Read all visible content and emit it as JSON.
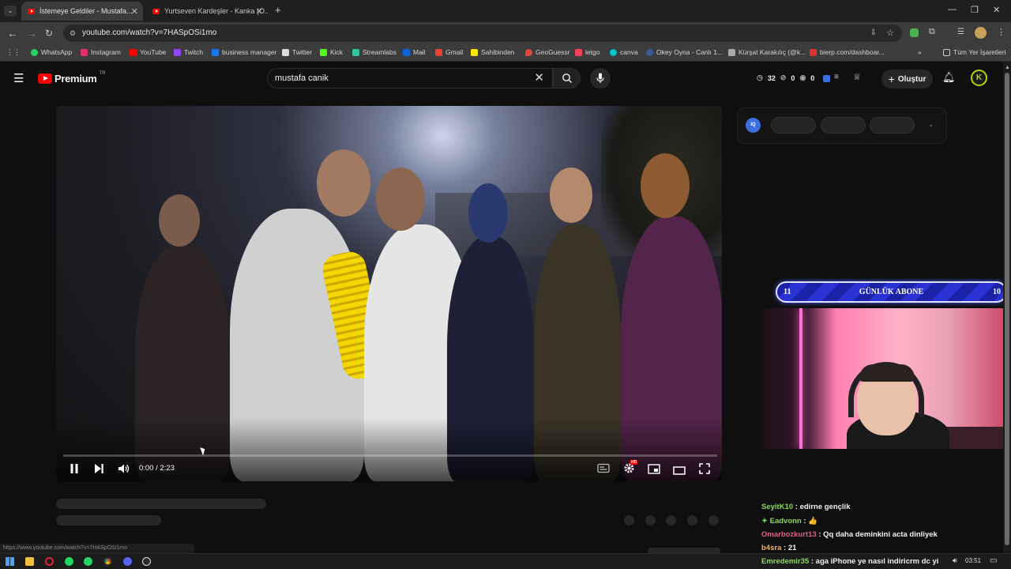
{
  "browser": {
    "tabs": [
      {
        "title": "İstemeye Geldiler - Mustafa..."
      },
      {
        "title": "Yurtseven Kardeşler - Kanka (O..."
      }
    ],
    "new_tab": "+",
    "url": "youtube.com/watch?v=7HASpOSi1mo",
    "bookmarks": [
      {
        "label": "WhatsApp",
        "color": "#25d366"
      },
      {
        "label": "Instagram",
        "color": "#e1306c"
      },
      {
        "label": "YouTube",
        "color": "#ff0000"
      },
      {
        "label": "Twitch",
        "color": "#9146ff"
      },
      {
        "label": "business manager",
        "color": "#1877f2"
      },
      {
        "label": "Twitter",
        "color": "#ffffff"
      },
      {
        "label": "Kick",
        "color": "#53fc18"
      },
      {
        "label": "Streamlabs",
        "color": "#31c3a2"
      },
      {
        "label": "Mail",
        "color": "#0a64d8"
      },
      {
        "label": "Gmail",
        "color": "#ea4335"
      },
      {
        "label": "Sahibinden",
        "color": "#ffe800"
      },
      {
        "label": "GeoGuessr",
        "color": "#e0463e"
      },
      {
        "label": "letgo",
        "color": "#ff3f55"
      },
      {
        "label": "canva",
        "color": "#00c4cc"
      },
      {
        "label": "Okey Oyna - Canlı 1...",
        "color": "#3b5998"
      },
      {
        "label": "Kürşat Karakılıç (@k...",
        "color": "#cccccc"
      },
      {
        "label": "bierp.com/dashboar...",
        "color": "#d33"
      }
    ],
    "all_bookmarks": "Tüm Yer İşaretleri",
    "status_url": "https://www.youtube.com/watch?v=7HASpOSi1mo"
  },
  "youtube": {
    "logo": "Premium",
    "region": "TR",
    "search_query": "mustafa canik",
    "stats": {
      "a": "32",
      "b": "0",
      "c": "0"
    },
    "create_label": "Oluştur",
    "avatar_letter": "K"
  },
  "player": {
    "time": "0:00 / 2:23",
    "progress": 0,
    "hd_badge": "HD"
  },
  "overlay": {
    "iq_label": "IQ",
    "subs": {
      "left": "11",
      "title": "GÜNLÜK ABONE",
      "right": "10"
    }
  },
  "chat": [
    {
      "user": "SeyitK10",
      "sep": " : ",
      "msg": "edirne gençlik",
      "color": "#8bd95b"
    },
    {
      "user": "Eadvonn",
      "sep": " : ",
      "msg": "👍",
      "color": "#8bd95b"
    },
    {
      "user": "Omarbozkurt13",
      "sep": " : ",
      "msg": "Qq daha deminkini acta dinliyek",
      "color": "#e05d86"
    },
    {
      "user": "b4sra",
      "sep": " : ",
      "msg": "21",
      "color": "#f0b15a"
    },
    {
      "user": "Emredemir35",
      "sep": " : ",
      "msg": "aga iPhone ye nasıl indiricrm dc yi",
      "color": "#8bd95b"
    }
  ],
  "taskbar": {
    "clock": "03:51"
  }
}
